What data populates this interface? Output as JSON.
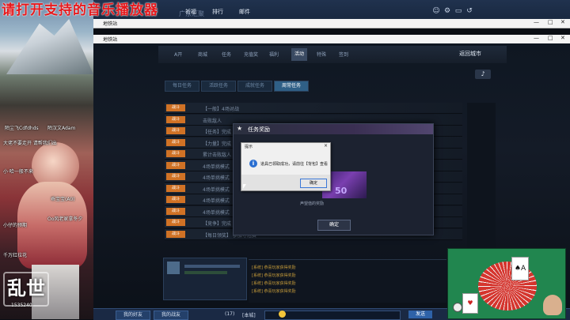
{
  "banner": {
    "text": "请打开支持的音乐播放器"
  },
  "overlay": {
    "stream_logo": "乱世",
    "viewer_counter": "1535240",
    "danmu": [
      "陌尘飞Cdfdhds",
      "陌汉文Adam",
      "大佬不要走开 请帮我们出",
      "小·哈一般不来",
      "Oo风老家拿冬夕",
      "乖宝宝(A0)",
      "小仔的预期",
      "千万红拉花"
    ]
  },
  "topstrip": {
    "ghost_title": "广东汇聚",
    "tabs": [
      "祈福",
      "排行",
      "邮件"
    ]
  },
  "window_background": {
    "title": "地铁站"
  },
  "window_game": {
    "title": "地铁站"
  },
  "nav": {
    "items": [
      "A开",
      "商城",
      "任务",
      "充值奖",
      "福利",
      "活动",
      "特殊",
      "签到"
    ],
    "active_index": 5,
    "back_city": "返回城市"
  },
  "subtabs": [
    "每日任务",
    "活跃任务",
    "成就任务",
    "周常任务"
  ],
  "subtabs_active_index": 3,
  "tasks": [
    {
      "badge": "战斗",
      "name": "【一般】4场对战"
    },
    {
      "badge": "战斗",
      "name": "击败敌人"
    },
    {
      "badge": "战斗",
      "name": "【任务】完成"
    },
    {
      "badge": "战斗",
      "name": "【力量】完成"
    },
    {
      "badge": "战斗",
      "name": "累计击败敌人"
    },
    {
      "badge": "战斗",
      "name": "4场单挑模式"
    },
    {
      "badge": "战斗",
      "name": "4场单挑模式"
    },
    {
      "badge": "战斗",
      "name": "4场单挑模式"
    },
    {
      "badge": "战斗",
      "name": "4场单挑模式"
    },
    {
      "badge": "战斗",
      "name": "4场单挑模式"
    },
    {
      "badge": "战斗",
      "name": "【竞争】完成"
    },
    {
      "badge": "战斗",
      "name": "【每日领奖】 参加夺冠赛"
    }
  ],
  "reward_dialog": {
    "title": "任务奖励",
    "amount": "50",
    "caption": "声望值的奖励",
    "ok_label": "确定"
  },
  "message_box": {
    "title": "提示",
    "close": "×",
    "text": "道具已领取成功，请前往【背包】查看",
    "ok_label": "确定"
  },
  "chat_lines": [
    "[系统] 恭喜玩家获得奖励",
    "[系统] 恭喜玩家获得奖励",
    "[系统] 恭喜玩家获得奖励",
    "[系统] 恭喜玩家获得奖励"
  ],
  "taskbar": {
    "buttons": [
      "我的好友",
      "我的战友"
    ],
    "count": "(17)",
    "channel": "[本城]",
    "send_label": "发送"
  },
  "cardcam": {
    "top_card": "♠A",
    "bottom_card": "♥"
  },
  "colors": {
    "accent_orange": "#d07225",
    "go_red": "#c34427",
    "banner_red": "#e6181c",
    "table_green": "#21864f"
  }
}
